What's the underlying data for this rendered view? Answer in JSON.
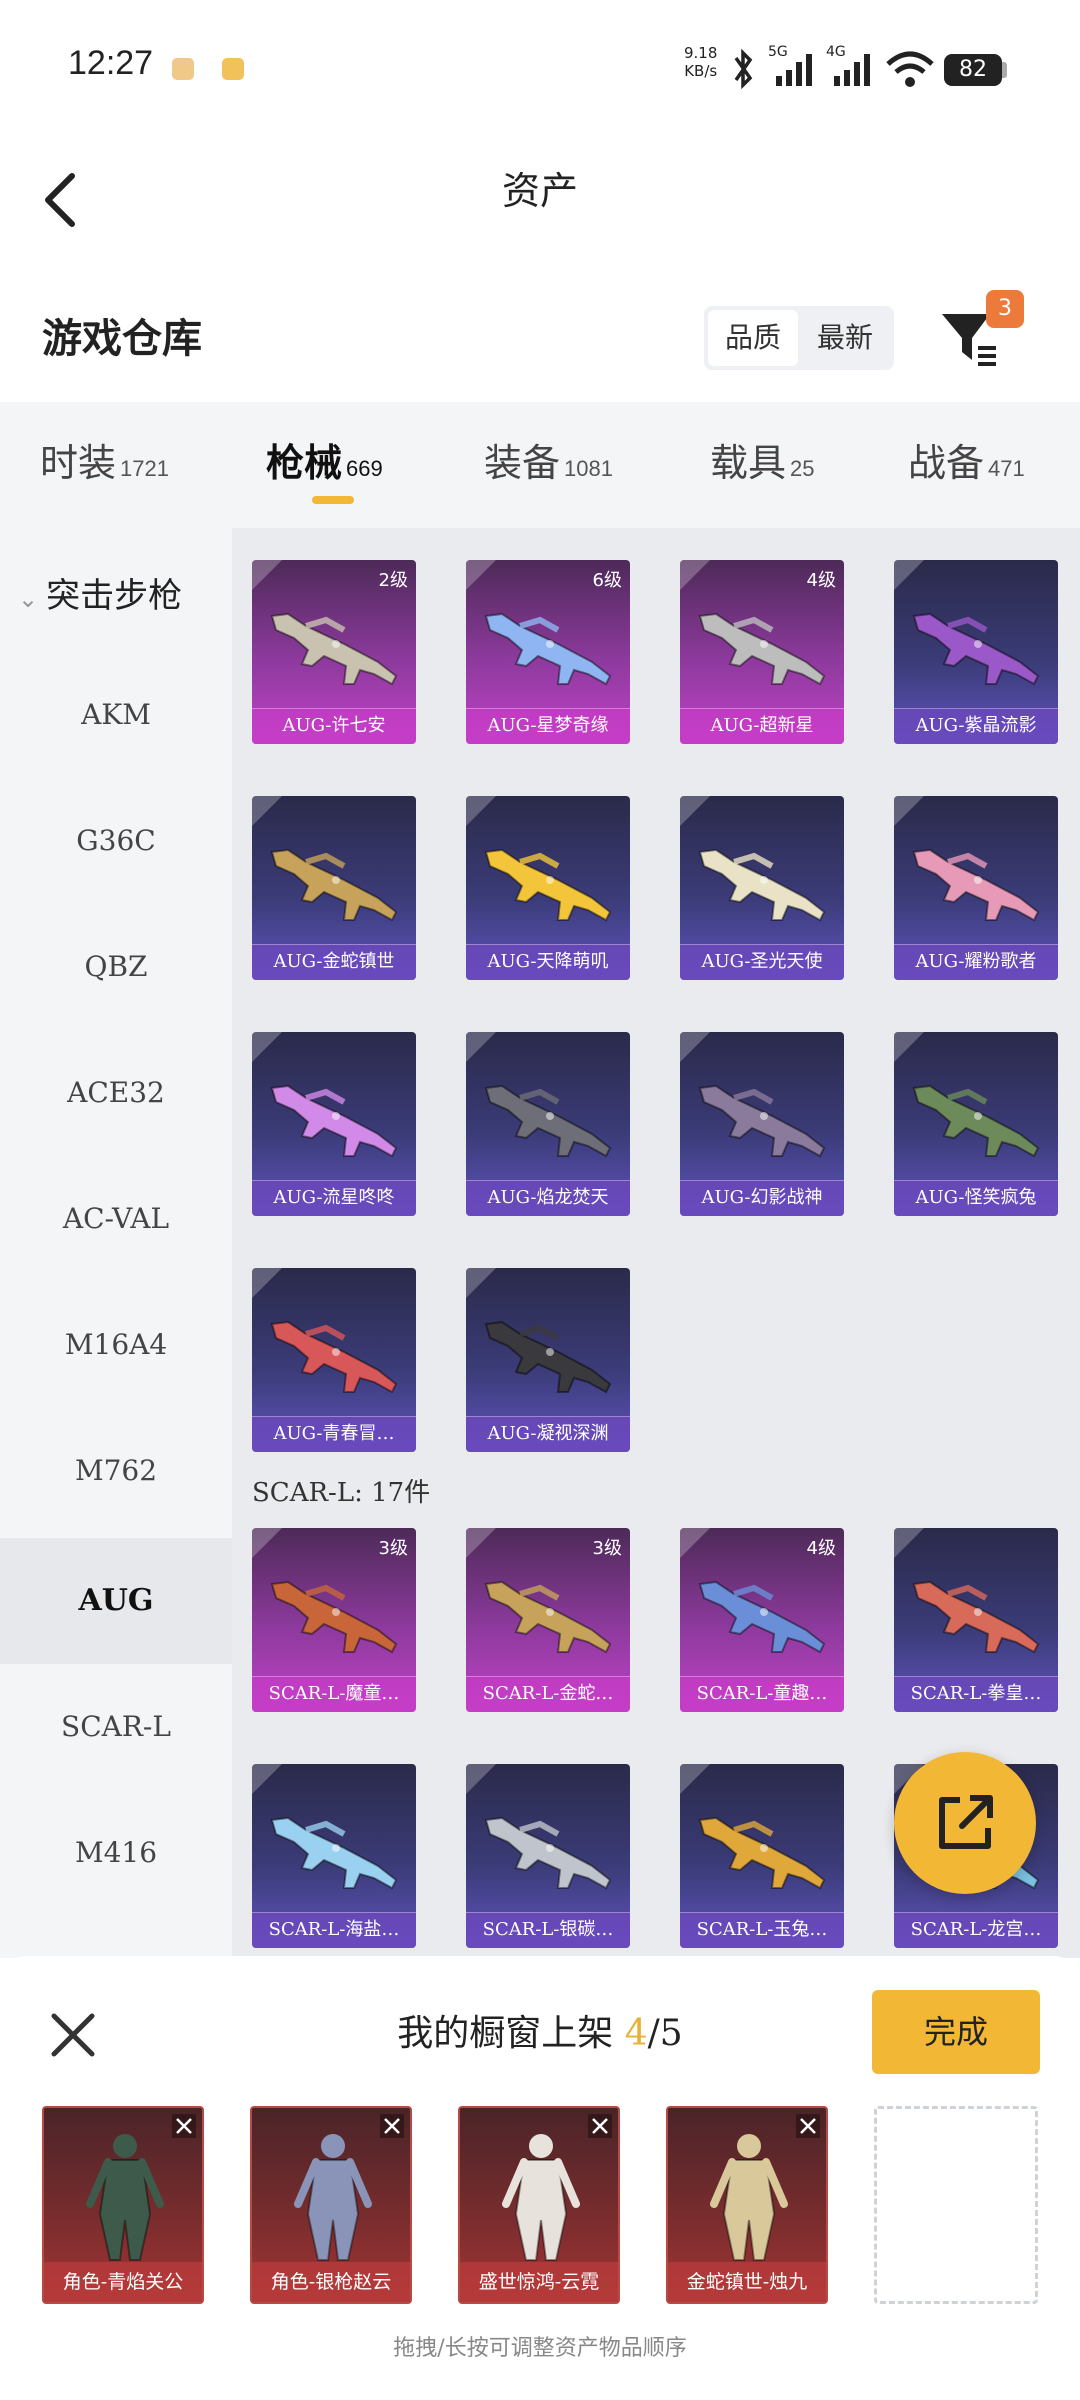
{
  "status_bar": {
    "time": "12:27",
    "net_rate": "9.18",
    "net_unit": "KB/s",
    "sig1": "5G",
    "sig2": "4G",
    "battery": "82"
  },
  "header": {
    "title": "资产"
  },
  "warehouse": {
    "title": "游戏仓库",
    "sort_quality": "品质",
    "sort_newest": "最新",
    "filter_count": "3"
  },
  "tabs": [
    {
      "label": "时装",
      "count": "1721"
    },
    {
      "label": "枪械",
      "count": "669"
    },
    {
      "label": "装备",
      "count": "1081"
    },
    {
      "label": "载具",
      "count": "25"
    },
    {
      "label": "战备",
      "count": "471"
    }
  ],
  "sidebar": {
    "category": "突击步枪",
    "items": [
      "AKM",
      "G36C",
      "QBZ",
      "ACE32",
      "AC-VAL",
      "M16A4",
      "M762",
      "AUG",
      "SCAR-L",
      "M416"
    ],
    "active": "AUG"
  },
  "sections": {
    "scar_label": "SCAR-L: 17件"
  },
  "aug_items": [
    {
      "name": "AUG-许七安",
      "level": "2级",
      "tier": "pink",
      "color": "#c9c2b0"
    },
    {
      "name": "AUG-星梦奇缘",
      "level": "6级",
      "tier": "pink",
      "color": "#8fb6f2"
    },
    {
      "name": "AUG-超新星",
      "level": "4级",
      "tier": "pink",
      "color": "#bdbdbd"
    },
    {
      "name": "AUG-紫晶流影",
      "level": "",
      "tier": "blue",
      "color": "#9a58c8"
    },
    {
      "name": "AUG-金蛇镇世",
      "level": "",
      "tier": "blue",
      "color": "#c6a25a"
    },
    {
      "name": "AUG-天降萌叽",
      "level": "",
      "tier": "blue",
      "color": "#f2c53a"
    },
    {
      "name": "AUG-圣光天使",
      "level": "",
      "tier": "blue",
      "color": "#eae2c6"
    },
    {
      "name": "AUG-耀粉歌者",
      "level": "",
      "tier": "blue",
      "color": "#e79ab8"
    },
    {
      "name": "AUG-流星咚咚",
      "level": "",
      "tier": "blue",
      "color": "#d18ae8"
    },
    {
      "name": "AUG-焰龙焚天",
      "level": "",
      "tier": "blue",
      "color": "#6e6e78"
    },
    {
      "name": "AUG-幻影战神",
      "level": "",
      "tier": "blue",
      "color": "#8a7a9c"
    },
    {
      "name": "AUG-怪笑疯兔",
      "level": "",
      "tier": "blue",
      "color": "#6c8a5a"
    },
    {
      "name": "AUG-青春冒…",
      "level": "",
      "tier": "blue",
      "color": "#d8585a"
    },
    {
      "name": "AUG-凝视深渊",
      "level": "",
      "tier": "blue",
      "color": "#3a3a3e"
    }
  ],
  "scar_items": [
    {
      "name": "SCAR-L-魔童…",
      "level": "3级",
      "tier": "pink",
      "color": "#c8663a"
    },
    {
      "name": "SCAR-L-金蛇…",
      "level": "3级",
      "tier": "pink",
      "color": "#c6a25a"
    },
    {
      "name": "SCAR-L-童趣…",
      "level": "4级",
      "tier": "pink",
      "color": "#6a8fd8"
    },
    {
      "name": "SCAR-L-拳皇…",
      "level": "",
      "tier": "blue",
      "color": "#d86a5a"
    },
    {
      "name": "SCAR-L-海盐…",
      "level": "",
      "tier": "blue",
      "color": "#9ad0f0"
    },
    {
      "name": "SCAR-L-银碳…",
      "level": "",
      "tier": "blue",
      "color": "#c0c4cc"
    },
    {
      "name": "SCAR-L-玉兔…",
      "level": "",
      "tier": "blue",
      "color": "#e0a83a"
    },
    {
      "name": "SCAR-L-龙宫…",
      "level": "",
      "tier": "blue",
      "color": "#7ac0e0"
    }
  ],
  "showcase": {
    "title": "我的橱窗上架",
    "count": "4",
    "total": "/5",
    "done_label": "完成",
    "slots": [
      {
        "name": "角色-青焰关公",
        "color": "#3e5a4a"
      },
      {
        "name": "角色-银枪赵云",
        "color": "#8a94b8"
      },
      {
        "name": "盛世惊鸿-云霓",
        "color": "#e8e2dc"
      },
      {
        "name": "金蛇镇世-烛九",
        "color": "#d8c89a"
      }
    ],
    "hint": "拖拽/长按可调整资产物品顺序"
  }
}
